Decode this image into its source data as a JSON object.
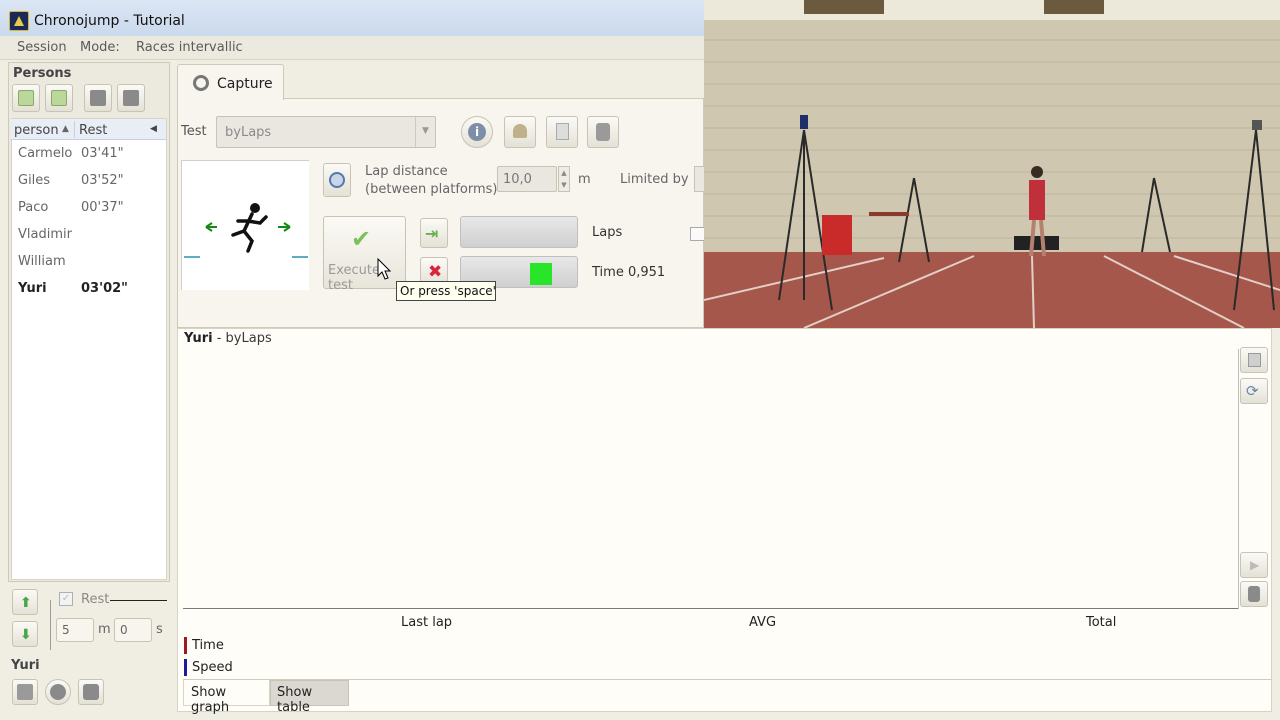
{
  "window": {
    "title": "Chronojump - Tutorial"
  },
  "menu": {
    "session": "Session",
    "mode": "Mode:",
    "current_mode": "Races intervallic"
  },
  "persons_panel": {
    "title": "Persons",
    "columns": {
      "person": "person",
      "rest": "Rest"
    },
    "rows": [
      {
        "name": "Carmelo",
        "rest": "03'41\""
      },
      {
        "name": "Giles",
        "rest": "03'52\""
      },
      {
        "name": "Paco",
        "rest": "00'37\""
      },
      {
        "name": "Vladimir",
        "rest": ""
      },
      {
        "name": "William",
        "rest": ""
      },
      {
        "name": "Yuri",
        "rest": "03'02\"",
        "selected": true
      }
    ],
    "rest_label": "Rest",
    "rest_minutes": "5",
    "rest_minutes_unit": "m",
    "rest_seconds": "0",
    "rest_seconds_unit": "s",
    "current_person": "Yuri"
  },
  "capture": {
    "tab_label": "Capture",
    "test_label": "Test",
    "test_value": "byLaps",
    "lap_distance_label_1": "Lap distance",
    "lap_distance_label_2": "(between platforms)",
    "lap_distance_value": "10,0",
    "lap_distance_unit": "m",
    "limited_by_label": "Limited by",
    "execute_label": "Execute test",
    "tooltip": "Or press 'space'",
    "laps_label": "Laps",
    "time_label": "Time 0,951",
    "status_color": "#29e529"
  },
  "results": {
    "header_person": "Yuri",
    "header_test": " - byLaps",
    "columns": {
      "last_lap": "Last lap",
      "avg": "AVG",
      "total": "Total"
    },
    "legend": [
      {
        "label": "Time",
        "color": "#9b1c1c"
      },
      {
        "label": "Speed",
        "color": "#1c1c9b"
      }
    ],
    "tab_graph": "Show graph",
    "tab_table": "Show table"
  }
}
